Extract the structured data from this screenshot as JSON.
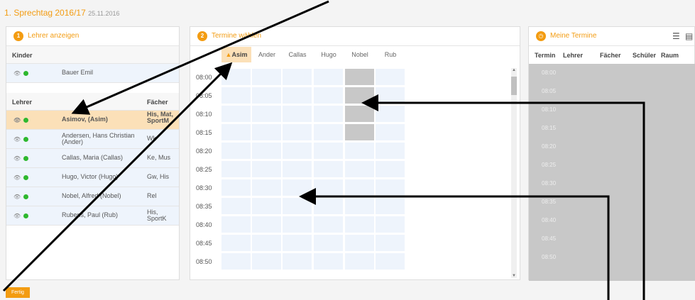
{
  "page": {
    "title": "1. Sprechtag 2016/17",
    "date": "25.11.2016",
    "colors": {
      "accent": "#f39c12",
      "selected": "#fbe0b8",
      "cell": "#eef4fc",
      "blocked": "#c8c8c8",
      "online": "#2eb82e"
    }
  },
  "left": {
    "step": "1",
    "title": "Lehrer anzeigen",
    "kinder_header": "Kinder",
    "kinder": [
      {
        "name": "Bauer Emil"
      }
    ],
    "lehrer_header": "Lehrer",
    "faecher_header": "Fächer",
    "lehrer": [
      {
        "name": "Asimov, (Asim)",
        "faecher": "His, Mat, SportM",
        "selected": true
      },
      {
        "name": "Andersen, Hans Christian (Ander)",
        "faecher": "Wk"
      },
      {
        "name": "Callas, Maria (Callas)",
        "faecher": "Ke, Mus"
      },
      {
        "name": "Hugo, Victor (Hugo)",
        "faecher": "Gw, His"
      },
      {
        "name": "Nobel, Alfred (Nobel)",
        "faecher": "Rel"
      },
      {
        "name": "Rubens, Paul (Rub)",
        "faecher": "His, SportK"
      }
    ]
  },
  "middle": {
    "step": "2",
    "title": "Termine wählen",
    "teachers": [
      "Asim",
      "Ander",
      "Callas",
      "Hugo",
      "Nobel",
      "Rub"
    ],
    "times": [
      "08:00",
      "08:05",
      "08:10",
      "08:15",
      "08:20",
      "08:25",
      "08:30",
      "08:35",
      "08:40",
      "08:45",
      "08:50"
    ]
  },
  "right": {
    "title": "Meine Termine",
    "icons": [
      "print-icon",
      "pdf-icon"
    ],
    "columns": [
      "Termin",
      "Lehrer",
      "Fächer",
      "Schüler",
      "Raum"
    ],
    "times": [
      "08:00",
      "08:05",
      "08:10",
      "08:15",
      "08:20",
      "08:25",
      "08:30",
      "08:35",
      "08:40",
      "08:45",
      "08:50"
    ]
  },
  "footer": {
    "fertig_label": "Fertig"
  }
}
